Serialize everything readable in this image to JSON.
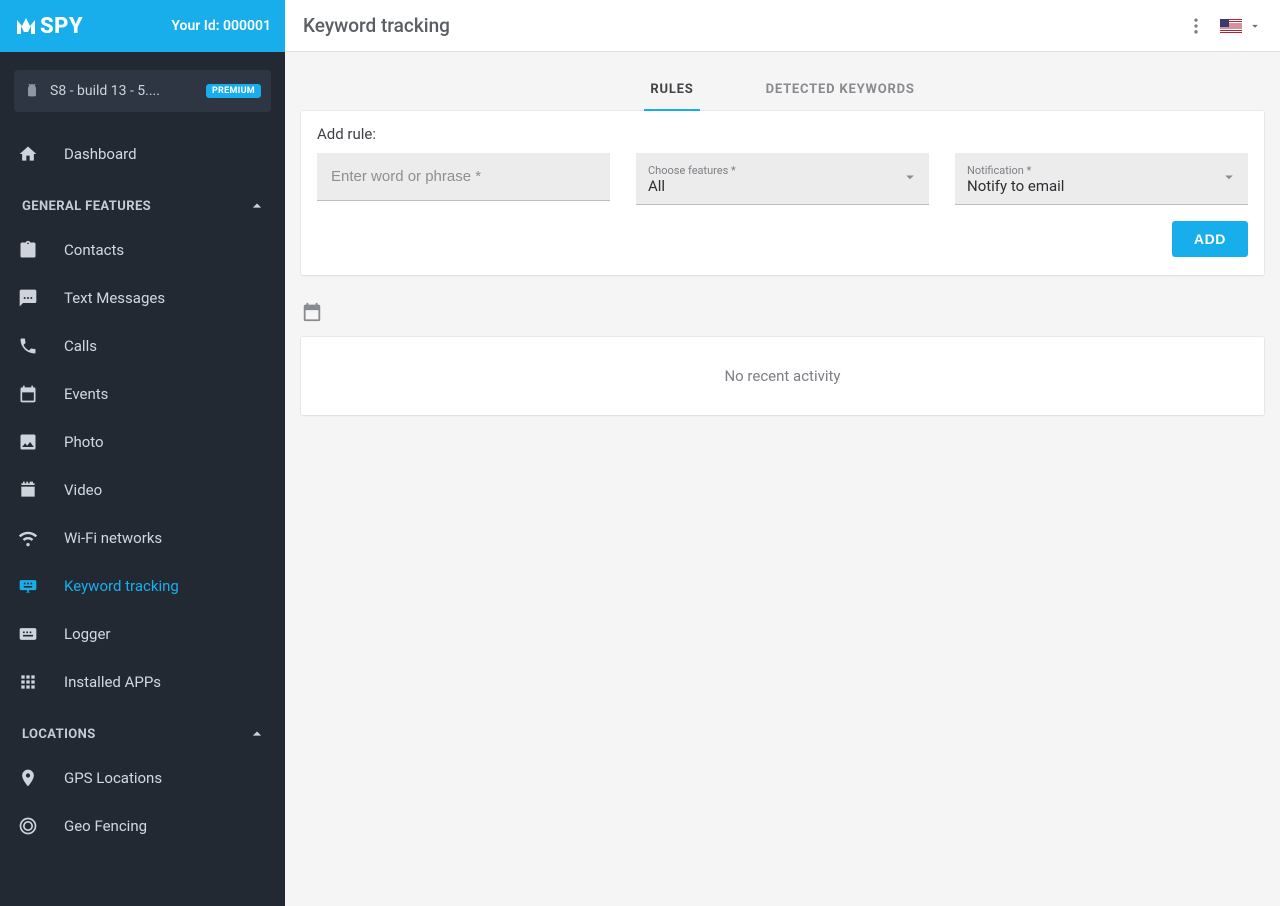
{
  "brand": "SPY",
  "your_id_label": "Your Id: 000001",
  "device": {
    "name": "S8 - build 13 - 5....",
    "badge": "PREMIUM"
  },
  "dashboard": "Dashboard",
  "sections": {
    "general": {
      "title": "GENERAL FEATURES",
      "items": [
        "Contacts",
        "Text Messages",
        "Calls",
        "Events",
        "Photo",
        "Video",
        "Wi-Fi networks",
        "Keyword tracking",
        "Logger",
        "Installed APPs"
      ],
      "active_index": 7
    },
    "locations": {
      "title": "LOCATIONS",
      "items": [
        "GPS Locations",
        "Geo Fencing"
      ]
    }
  },
  "page": {
    "title": "Keyword tracking",
    "tabs": {
      "rules": "RULES",
      "detected": "DETECTED KEYWORDS"
    },
    "add_rule": {
      "heading": "Add rule:",
      "input_placeholder": "Enter word or phrase *",
      "features_label": "Choose features *",
      "features_value": "All",
      "notif_label": "Notification *",
      "notif_value": "Notify to email",
      "add_btn": "ADD"
    },
    "empty": "No recent activity"
  }
}
